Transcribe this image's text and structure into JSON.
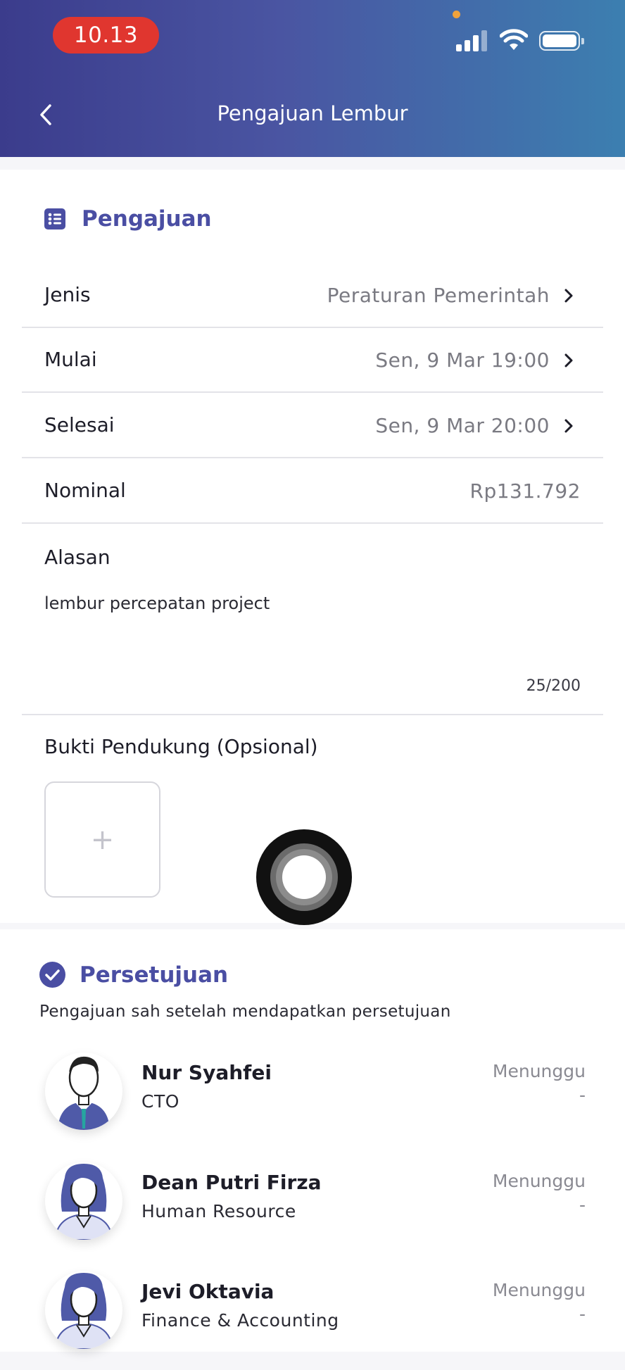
{
  "status_bar": {
    "time": "10.13"
  },
  "header": {
    "title": "Pengajuan Lembur"
  },
  "pengajuan": {
    "section_title": "Pengajuan",
    "rows": [
      {
        "label": "Jenis",
        "value": "Peraturan Pemerintah"
      },
      {
        "label": "Mulai",
        "value": "Sen, 9 Mar 19:00"
      },
      {
        "label": "Selesai",
        "value": "Sen, 9 Mar 20:00"
      },
      {
        "label": "Nominal",
        "value": "Rp131.792"
      }
    ],
    "alasan": {
      "label": "Alasan",
      "text": "lembur percepatan project",
      "counter": "25/200"
    },
    "bukti": {
      "label": "Bukti Pendukung (Opsional)",
      "add_symbol": "+"
    }
  },
  "persetujuan": {
    "section_title": "Persetujuan",
    "subtitle": "Pengajuan sah setelah mendapatkan persetujuan",
    "approvers": [
      {
        "name": "Nur Syahfei",
        "role": "CTO",
        "status": "Menunggu",
        "date": "-"
      },
      {
        "name": "Dean Putri Firza",
        "role": "Human Resource",
        "status": "Menunggu",
        "date": "-"
      },
      {
        "name": "Jevi Oktavia",
        "role": "Finance & Accounting",
        "status": "Menunggu",
        "date": "-"
      }
    ]
  },
  "colors": {
    "accent": "#4a4ea3",
    "status_pill": "#e0362f",
    "header_gradient_start": "#3b3c8c",
    "header_gradient_end": "#3c7fb0"
  },
  "icons": [
    "back-arrow-icon",
    "list-icon",
    "chevron-right-icon",
    "check-circle-icon",
    "plus-icon",
    "signal-icon",
    "wifi-icon",
    "battery-icon"
  ]
}
